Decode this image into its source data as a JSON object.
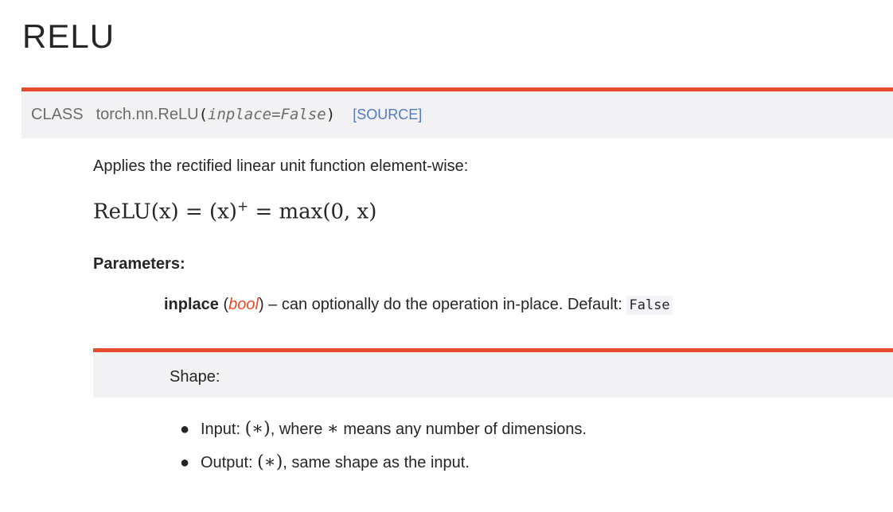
{
  "page": {
    "title": "RELU"
  },
  "class_signature": {
    "keyword": "CLASS",
    "name": "torch.nn.ReLU",
    "open_paren": "(",
    "param": "inplace=False",
    "close_paren": ")",
    "source_link": "[SOURCE]"
  },
  "description": "Applies the rectified linear unit function element-wise:",
  "formula": {
    "lhs": "ReLU(x) = (x)",
    "superscript": "+",
    "rhs": " = max(0, x)"
  },
  "parameters": {
    "label": "Parameters:",
    "items": [
      {
        "name": "inplace",
        "type_open": " (",
        "type": "bool",
        "type_close": ")",
        "description": " – can optionally do the operation in-place. Default: ",
        "default": "False"
      }
    ]
  },
  "shape": {
    "title": "Shape:",
    "items": [
      {
        "label": "Input: ",
        "math": "(∗)",
        "text_a": ", where ",
        "math2": "∗",
        "text_b": " means any number of dimensions."
      },
      {
        "label": "Output: ",
        "math": "(∗)",
        "text_a": ", same shape as the input.",
        "math2": "",
        "text_b": ""
      }
    ]
  }
}
